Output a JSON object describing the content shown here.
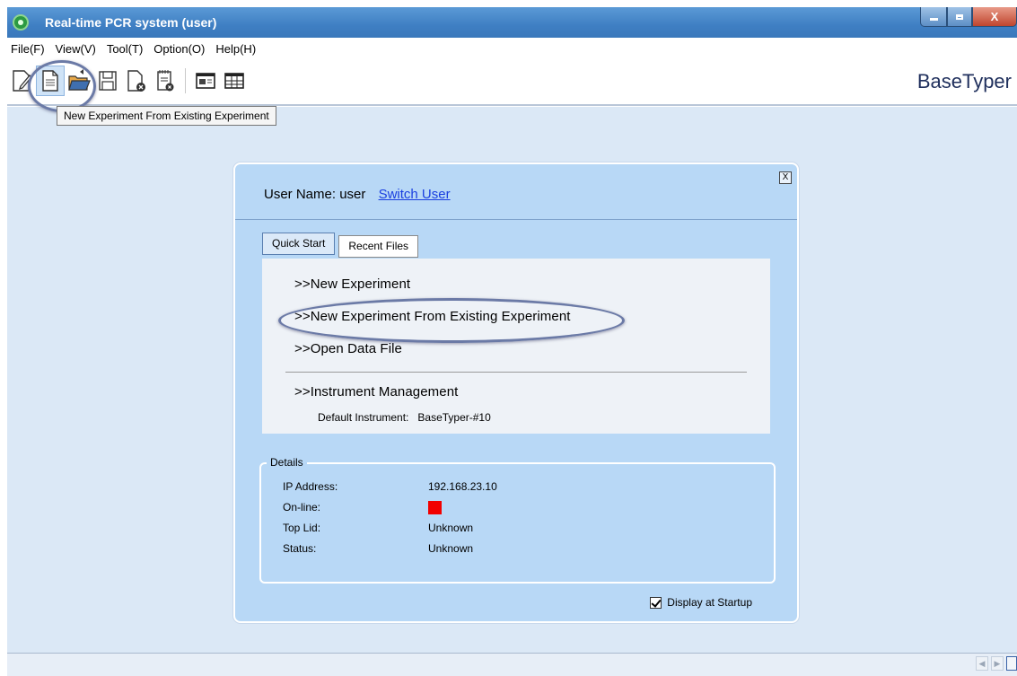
{
  "window": {
    "title": "Real-time PCR system (user)",
    "controls": {
      "minimize": "minimize",
      "maximize": "maximize",
      "close": "X"
    }
  },
  "menu": [
    "File(F)",
    "View(V)",
    "Tool(T)",
    "Option(O)",
    "Help(H)"
  ],
  "toolbar": {
    "icons": [
      "edit-document-icon",
      "new-document-icon",
      "open-folder-icon",
      "save-icon",
      "close-document-icon",
      "export-icon",
      "window-layout-icon",
      "table-grid-icon"
    ],
    "brand": "BaseTyper",
    "tooltip": "New Experiment From Existing Experiment"
  },
  "dialog": {
    "close_label": "X",
    "user_label": "User Name:",
    "user_name": "user",
    "switch_user": "Switch User",
    "tabs": [
      "Quick Start",
      "Recent Files"
    ],
    "links": {
      "new_experiment": ">>New Experiment",
      "new_from_existing": ">>New Experiment From Existing Experiment",
      "open_data_file": ">>Open Data File",
      "instrument_management": ">>Instrument Management"
    },
    "default_instrument_label": "Default Instrument:",
    "default_instrument_value": "BaseTyper-#10",
    "details": {
      "legend": "Details",
      "ip_label": "IP Address:",
      "ip_value": "192.168.23.10",
      "online_label": "On-line:",
      "online_color": "#f20000",
      "toplid_label": "Top Lid:",
      "toplid_value": "Unknown",
      "status_label": "Status:",
      "status_value": "Unknown"
    },
    "display_at_startup": "Display at Startup",
    "display_at_startup_checked": true
  }
}
